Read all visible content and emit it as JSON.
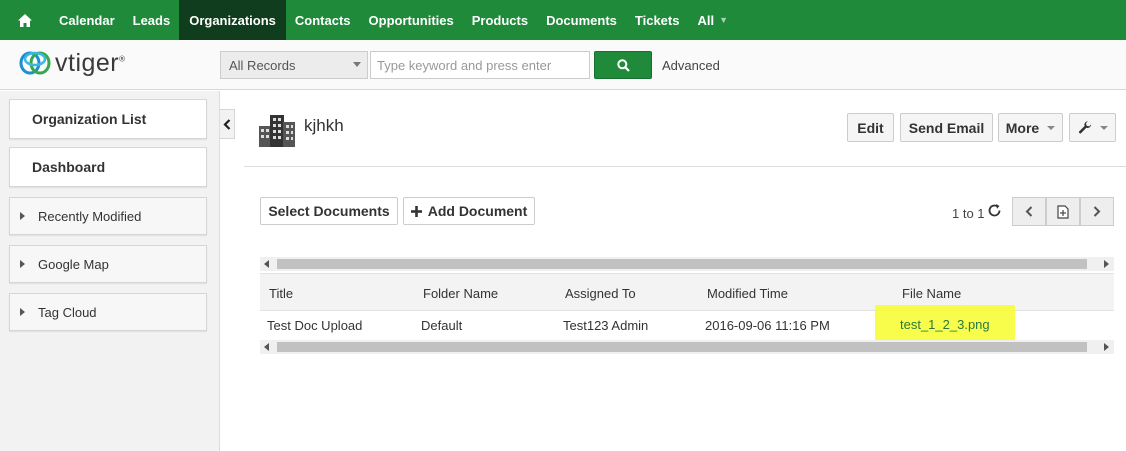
{
  "nav": {
    "items": [
      {
        "label": "Calendar"
      },
      {
        "label": "Leads"
      },
      {
        "label": "Organizations",
        "active": true
      },
      {
        "label": "Contacts"
      },
      {
        "label": "Opportunities"
      },
      {
        "label": "Products"
      },
      {
        "label": "Documents"
      },
      {
        "label": "Tickets"
      },
      {
        "label": "All"
      }
    ]
  },
  "header": {
    "logo_text": "vtiger",
    "records_select": "All Records",
    "search_placeholder": "Type keyword and press enter",
    "advanced_label": "Advanced"
  },
  "sidebar": {
    "organization_list": "Organization List",
    "dashboard": "Dashboard",
    "widgets": [
      "Recently Modified",
      "Google Map",
      "Tag Cloud"
    ]
  },
  "record": {
    "title": "kjhkh",
    "buttons": {
      "edit": "Edit",
      "send_email": "Send Email",
      "more": "More"
    }
  },
  "documents": {
    "select_label": "Select Documents",
    "add_label": "Add Document",
    "page_info": "1 to 1",
    "columns": [
      "Title",
      "Folder Name",
      "Assigned To",
      "Modified Time",
      "File Name"
    ],
    "rows": [
      {
        "title": "Test Doc Upload",
        "folder": "Default",
        "assigned": "Test123 Admin",
        "modified": "2016-09-06 11:16 PM",
        "file": "test_1_2_3.png"
      }
    ]
  },
  "colors": {
    "nav_green": "#1f8a3a",
    "nav_active": "#0f3d1d",
    "link_green": "#2b7a3c",
    "highlight": "#f7fb2c"
  },
  "icons": [
    "home-icon",
    "search-icon",
    "chevron-left-icon",
    "building-icon",
    "wrench-icon",
    "refresh-icon",
    "chevron-right-icon",
    "page-icon"
  ]
}
